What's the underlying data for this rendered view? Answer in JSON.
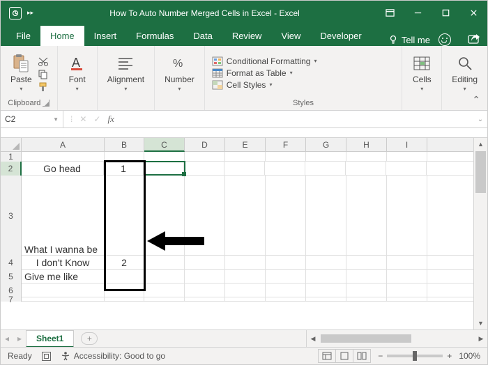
{
  "title": "How To Auto Number Merged Cells in Excel  -  Excel",
  "tabs": {
    "file": "File",
    "home": "Home",
    "insert": "Insert",
    "formulas": "Formulas",
    "data": "Data",
    "review": "Review",
    "view": "View",
    "developer": "Developer",
    "tellme": "Tell me"
  },
  "ribbon": {
    "clipboard": {
      "paste": "Paste",
      "label": "Clipboard"
    },
    "font": {
      "btn": "Font"
    },
    "alignment": {
      "btn": "Alignment"
    },
    "number": {
      "btn": "Number"
    },
    "styles": {
      "cond": "Conditional Formatting",
      "fmt": "Format as Table",
      "cell": "Cell Styles",
      "label": "Styles"
    },
    "cells": {
      "btn": "Cells"
    },
    "editing": {
      "btn": "Editing"
    }
  },
  "formula_bar": {
    "name_box": "C2",
    "fx": "fx",
    "value": ""
  },
  "columns": [
    "A",
    "B",
    "C",
    "D",
    "E",
    "F",
    "G",
    "H",
    "I"
  ],
  "row_numbers": [
    "1",
    "2",
    "3",
    "4",
    "5",
    "6",
    "7"
  ],
  "cells": {
    "A2": "Go head",
    "A3": "What I wanna be",
    "A4": "I don't Know",
    "A5": "Give me like",
    "B2": "1",
    "B4": "2"
  },
  "sheet": {
    "name": "Sheet1",
    "add": "+"
  },
  "status": {
    "ready": "Ready",
    "acc": "Accessibility: Good to go",
    "zoom": "100%",
    "minus": "−",
    "plus": "+"
  }
}
